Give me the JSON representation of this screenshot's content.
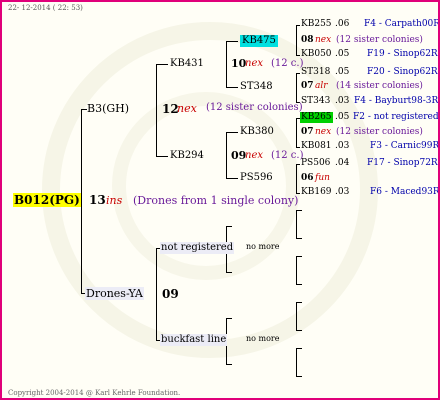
{
  "header": {
    "date": "22- 12-2014 ( 22: 53)"
  },
  "footer": {
    "copyright": "Copyright 2004-2014 @ Karl Kehrle Foundation."
  },
  "colors": {
    "frame": "#e0007a",
    "root_highlight": "#ffff00",
    "cyan_highlight": "#00e0e0",
    "green_highlight": "#00d000",
    "red_text": "#c80000",
    "blue_text": "#0000aa",
    "purple_text": "#6a1b9a"
  },
  "root": {
    "id": "B012(PG)",
    "num": "13",
    "tag": "ins",
    "note": "(Drones from 1 single colony)"
  },
  "sire": {
    "id": "B3(GH)",
    "num": "12",
    "tag": "nex",
    "note": "(12 sister colonies)",
    "left": {
      "id": "KB431",
      "num": "10",
      "tag": "nex",
      "note": "(12 c.)",
      "top": {
        "id": "KB475",
        "num": "08",
        "tag": "nex",
        "note": "(12 sister colonies)",
        "a": {
          "id": "KB255",
          "val": ".06",
          "ref": "F4 - Carpath00R"
        },
        "b": {
          "id": "KB050",
          "val": ".05",
          "ref": "F19 - Sinop62R"
        }
      },
      "bottom": {
        "id": "ST348",
        "num": "07",
        "tag": "alr",
        "note": "(14 sister colonies)",
        "a": {
          "id": "ST318",
          "val": ".05",
          "ref": "F20 - Sinop62R"
        },
        "b": {
          "id": "ST343",
          "val": ".03",
          "ref": "F4 - Bayburt98-3R"
        }
      }
    },
    "right": {
      "id": "KB294",
      "num": "09",
      "tag": "nex",
      "note": "(12 c.)",
      "top": {
        "id": "KB380",
        "num": "07",
        "tag": "nex",
        "note": "(12 sister colonies)",
        "a": {
          "id": "KB265",
          "val": ".05",
          "ref": "F2 - not registered"
        },
        "b": {
          "id": "KB081",
          "val": ".03",
          "ref": "F3 - Carnic99R"
        }
      },
      "bottom": {
        "id": "PS596",
        "num": "06",
        "tag": "fun",
        "note": "",
        "a": {
          "id": "PS506",
          "val": ".04",
          "ref": "F17 - Sinop72R"
        },
        "b": {
          "id": "KB169",
          "val": ".03",
          "ref": "F6 - Maced93R"
        }
      }
    }
  },
  "dam": {
    "id": "Drones-YA",
    "num": "09",
    "upper": {
      "label": "not registered",
      "more": "no more"
    },
    "lower": {
      "label": "buckfast line",
      "more": "no more"
    }
  }
}
